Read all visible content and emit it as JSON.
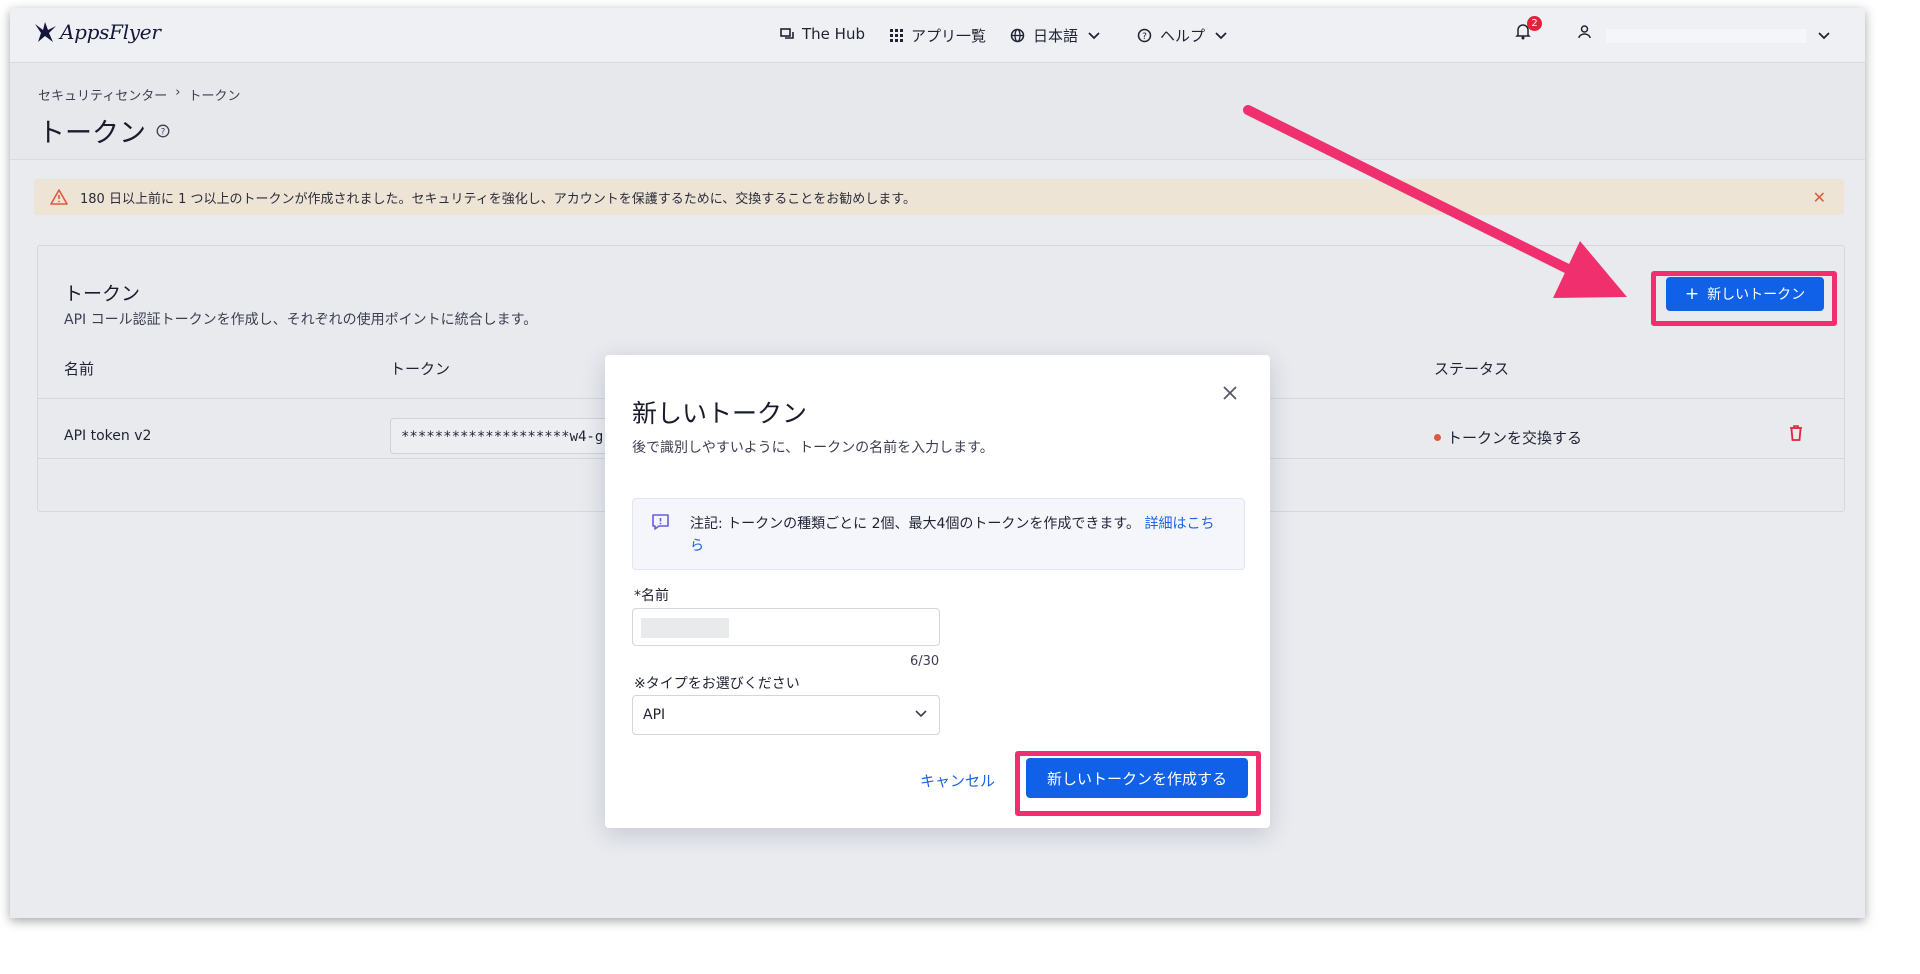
{
  "nav": {
    "logo": "AppsFlyer",
    "hub": "The Hub",
    "apps": "アプリ一覧",
    "language": "日本語",
    "help": "ヘルプ",
    "notification_count": "2"
  },
  "header": {
    "breadcrumb": [
      "セキュリティセンター",
      "トークン"
    ],
    "breadcrumb_separator": "›",
    "title": "トークン"
  },
  "warning": {
    "text": "180 日以上前に 1 つ以上のトークンが作成されました。セキュリティを強化し、アカウントを保護するために、交換することをお勧めします。",
    "close": "✕"
  },
  "card": {
    "title": "トークン",
    "subtitle": "API コール認証トークンを作成し、それぞれの使用ポイントに統合します。",
    "new_token_button": "新しいトークン",
    "columns": [
      "名前",
      "トークン",
      "ステータス"
    ],
    "rows": [
      {
        "name": "API token v2",
        "token": "********************w4-g",
        "status": "トークンを交換する"
      }
    ]
  },
  "modal": {
    "title": "新しいトークン",
    "subtitle": "後で識別しやすいように、トークンの名前を入力します。",
    "note": "注記: トークンの種類ごとに 2個、最大4個のトークンを作成できます。",
    "note_link": "詳細はこちら",
    "name_label": "*名前",
    "name_counter": "6/30",
    "type_label": "※タイプをお選びください",
    "type_value": "API",
    "cancel": "キャンセル",
    "create": "新しいトークンを作成する"
  },
  "colors": {
    "primary": "#1161e8",
    "highlight": "#f0306e",
    "warning_bg": "#eee4d6",
    "status_dot": "#e0583a"
  }
}
